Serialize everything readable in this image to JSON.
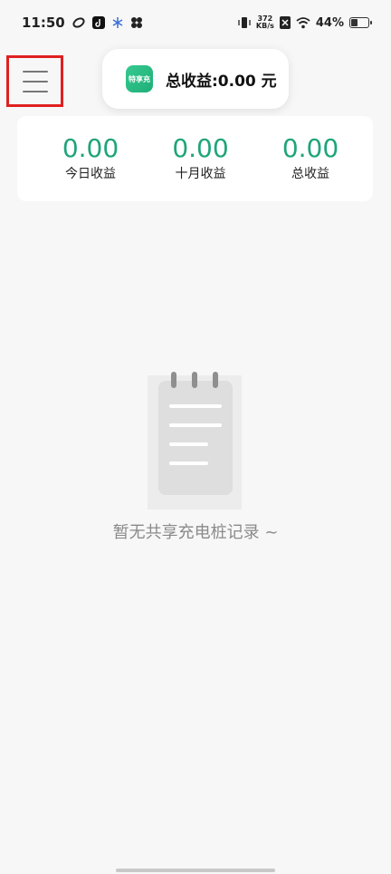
{
  "status_bar": {
    "time": "11:50",
    "net_speed_value": "372",
    "net_speed_unit": "KB/s",
    "battery_percent": "44%",
    "battery_level": 0.44
  },
  "header": {
    "total_label": "总收益:0.00 元",
    "app_logo_text": "特享充"
  },
  "stats": [
    {
      "value": "0.00",
      "label": "今日收益"
    },
    {
      "value": "0.00",
      "label": "十月收益"
    },
    {
      "value": "0.00",
      "label": "总收益"
    }
  ],
  "empty_state": {
    "message": "暂无共享充电桩记录 ~"
  },
  "icons": {
    "menu": "hamburger-menu-icon",
    "empty": "notepad-icon"
  },
  "colors": {
    "accent": "#1fa57a",
    "highlight_border": "#e02020"
  }
}
